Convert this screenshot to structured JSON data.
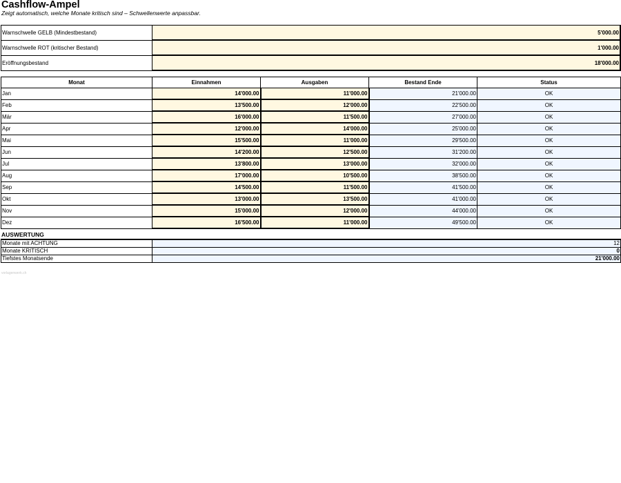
{
  "sheet": {
    "title": "Cashflow-Ampel",
    "subtitle": "Zeigt automatisch, welche Monate kritisch sind – Schwellenwerte anpassbar."
  },
  "parameters": [
    {
      "label": "Warnschwelle GELB (Mindestbestand)",
      "value": "5'000.00"
    },
    {
      "label": "Warnschwelle ROT (kritischer Bestand)",
      "value": "1'000.00"
    },
    {
      "label": "Eröffnungsbestand",
      "value": "18'000.00"
    }
  ],
  "table": {
    "headers": [
      "Monat",
      "Einnahmen",
      "Ausgaben",
      "Bestand Ende",
      "Status"
    ],
    "rows": [
      {
        "month": "Jan",
        "income": "14'000.00",
        "expenses": "11'000.00",
        "balance": "21'000.00",
        "status": "OK"
      },
      {
        "month": "Feb",
        "income": "13'500.00",
        "expenses": "12'000.00",
        "balance": "22'500.00",
        "status": "OK"
      },
      {
        "month": "Mär",
        "income": "16'000.00",
        "expenses": "11'500.00",
        "balance": "27'000.00",
        "status": "OK"
      },
      {
        "month": "Apr",
        "income": "12'000.00",
        "expenses": "14'000.00",
        "balance": "25'000.00",
        "status": "OK"
      },
      {
        "month": "Mai",
        "income": "15'500.00",
        "expenses": "11'000.00",
        "balance": "29'500.00",
        "status": "OK"
      },
      {
        "month": "Jun",
        "income": "14'200.00",
        "expenses": "12'500.00",
        "balance": "31'200.00",
        "status": "OK"
      },
      {
        "month": "Jul",
        "income": "13'800.00",
        "expenses": "13'000.00",
        "balance": "32'000.00",
        "status": "OK"
      },
      {
        "month": "Aug",
        "income": "17'000.00",
        "expenses": "10'500.00",
        "balance": "38'500.00",
        "status": "OK"
      },
      {
        "month": "Sep",
        "income": "14'500.00",
        "expenses": "11'500.00",
        "balance": "41'500.00",
        "status": "OK"
      },
      {
        "month": "Okt",
        "income": "13'000.00",
        "expenses": "13'500.00",
        "balance": "41'000.00",
        "status": "OK"
      },
      {
        "month": "Nov",
        "income": "15'000.00",
        "expenses": "12'000.00",
        "balance": "44'000.00",
        "status": "OK"
      },
      {
        "month": "Dez",
        "income": "16'500.00",
        "expenses": "11'000.00",
        "balance": "49'500.00",
        "status": "OK"
      }
    ]
  },
  "evaluation": {
    "heading": "AUSWERTUNG",
    "rows": [
      {
        "label": "Monate mit ACHTUNG",
        "value": "12",
        "bold": false
      },
      {
        "label": "Monate KRITISCH",
        "value": "0",
        "bold": true
      },
      {
        "label": "Tiefstes Monatsende",
        "value": "21'000.00",
        "bold": true
      }
    ]
  },
  "footer": "vorlagenwerk.ch",
  "colors": {
    "input_fill": "#fff8e1",
    "formula_fill": "#f0f6ff"
  }
}
